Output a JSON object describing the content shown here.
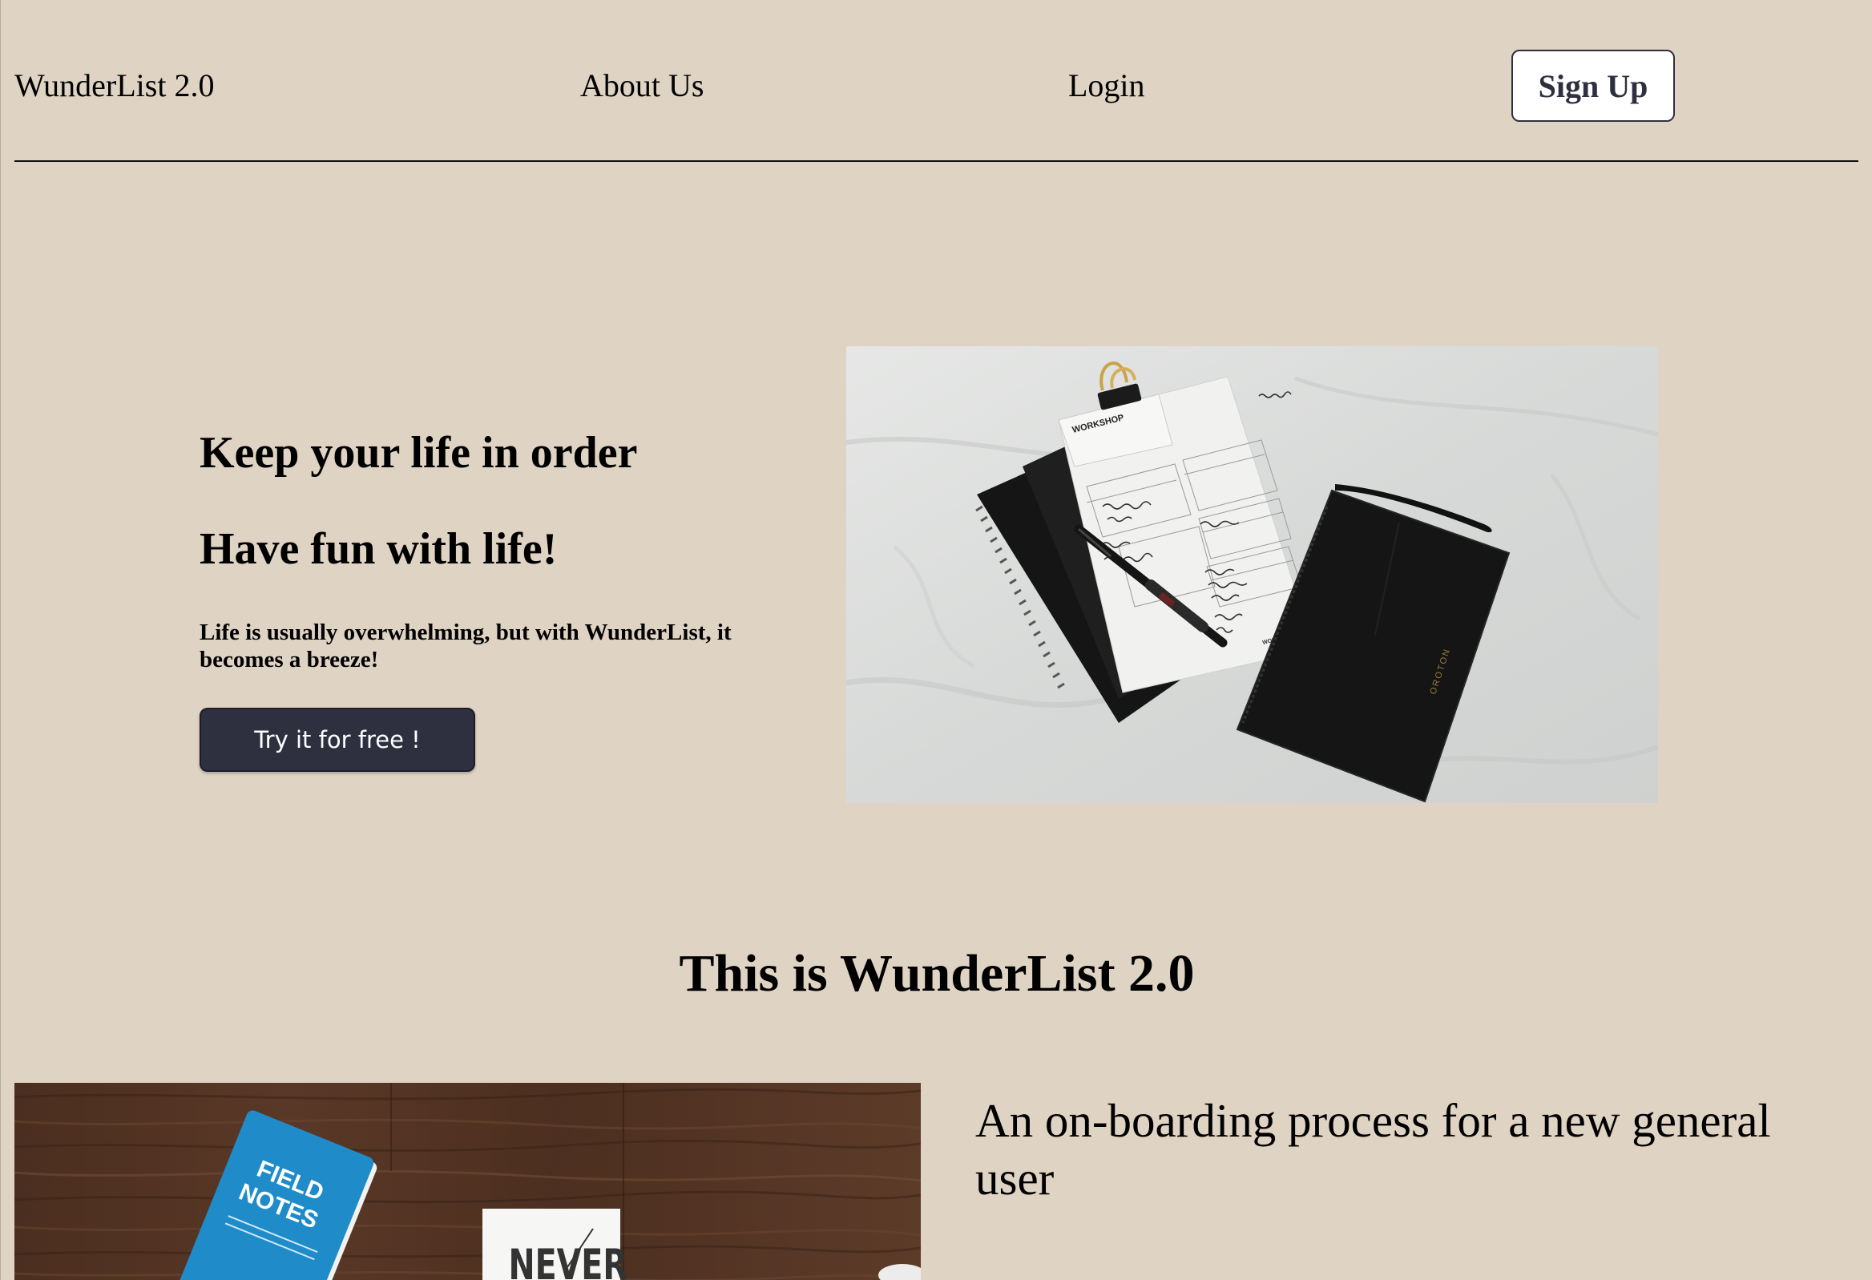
{
  "nav": {
    "logo": "WunderList 2.0",
    "about": "About Us",
    "login": "Login",
    "signup": "Sign Up"
  },
  "hero": {
    "heading1": "Keep your life in order",
    "heading2": "Have fun with life!",
    "description": "Life is usually overwhelming, but with WunderList, it becomes a breeze!",
    "cta": "Try it for free !",
    "image": {
      "notepad_brand": "WORKSHOP",
      "notepad_brand_footer": "WORKSHOPS",
      "wallet_brand": "OROTON"
    }
  },
  "section": {
    "title": "This is WunderList 2.0",
    "feature_text": "An on-boarding process for a new general user",
    "image": {
      "notebook_title_line1": "FIELD",
      "notebook_title_line2": "NOTES",
      "card_text": "NEVER"
    }
  },
  "colors": {
    "page_background": "#dfd3c3",
    "button_dark": "#2e3040",
    "button_light": "#ffffff"
  }
}
